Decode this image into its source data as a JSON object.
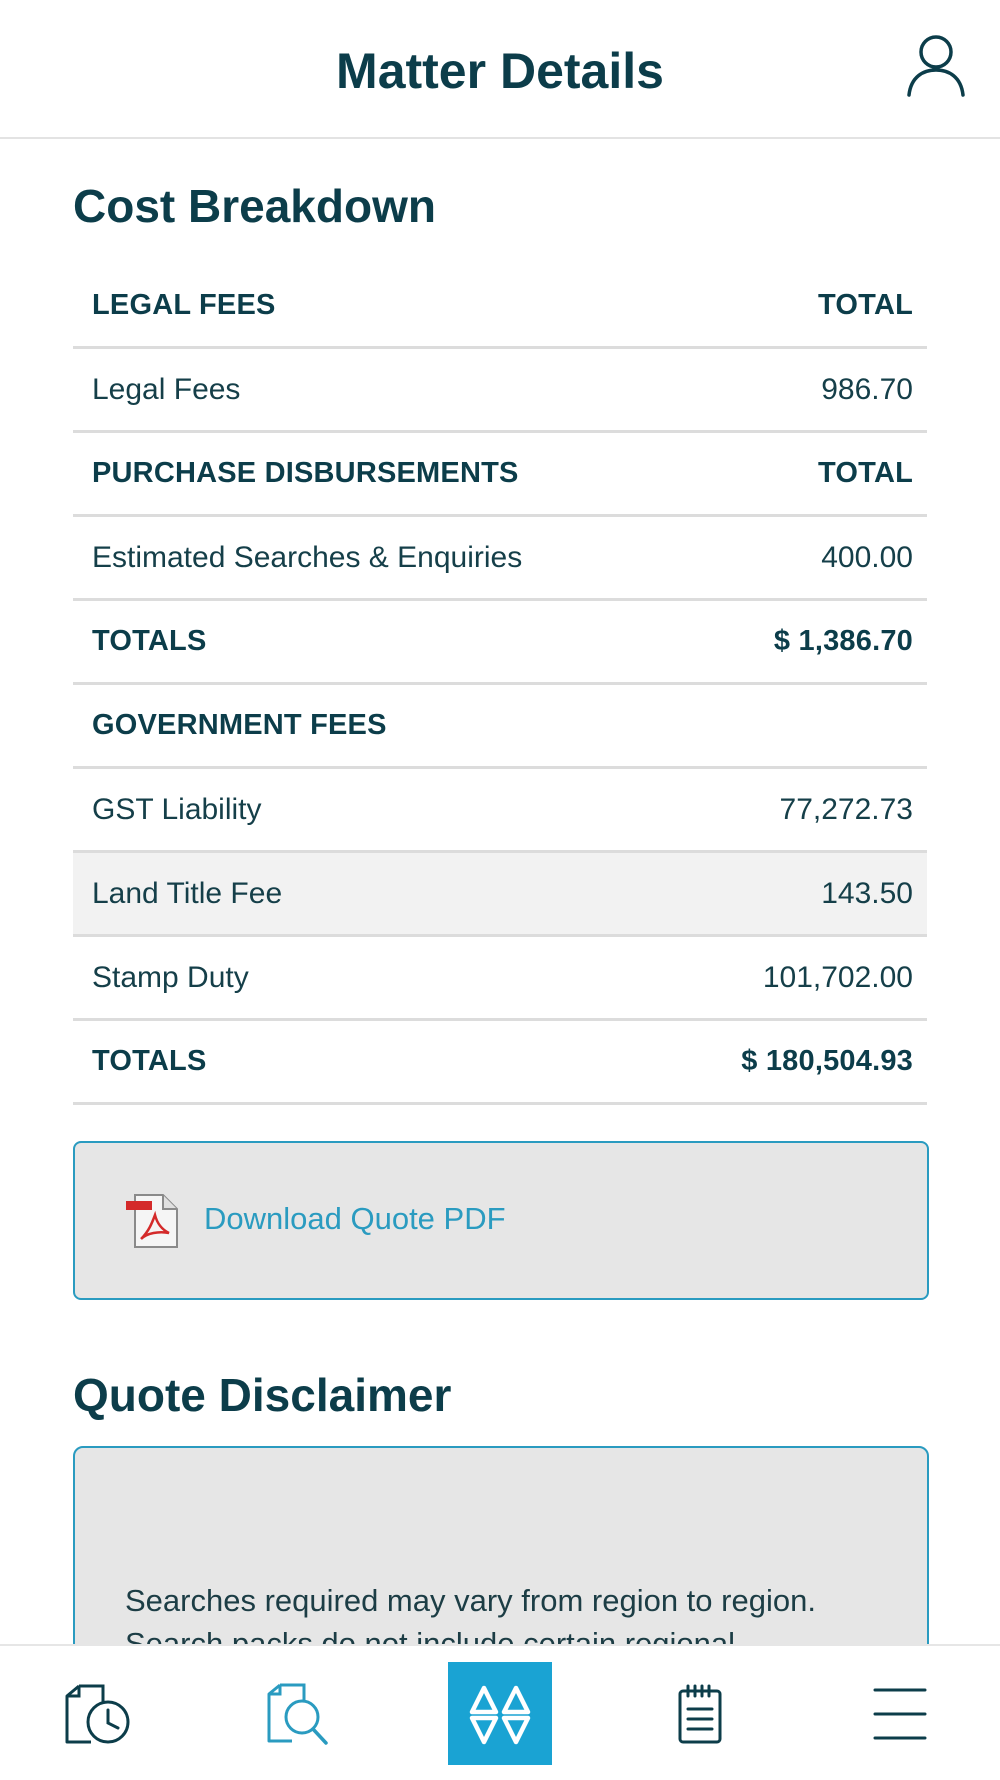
{
  "header": {
    "title": "Matter Details",
    "profile_icon": "user-icon"
  },
  "cost_breakdown": {
    "title": "Cost Breakdown",
    "rows": [
      {
        "type": "head",
        "label": "LEGAL FEES",
        "value": "TOTAL"
      },
      {
        "type": "item",
        "label": "Legal Fees",
        "value": "986.70"
      },
      {
        "type": "head",
        "label": "PURCHASE DISBURSEMENTS",
        "value": "TOTAL"
      },
      {
        "type": "item",
        "label": "Estimated Searches & Enquiries",
        "value": "400.00"
      },
      {
        "type": "head",
        "label": "TOTALS",
        "value": "$ 1,386.70"
      },
      {
        "type": "head",
        "label": "GOVERNMENT FEES",
        "value": ""
      },
      {
        "type": "item",
        "label": "GST Liability",
        "value": "77,272.73"
      },
      {
        "type": "item",
        "label": "Land Title Fee",
        "value": "143.50"
      },
      {
        "type": "item",
        "label": "Stamp Duty",
        "value": "101,702.00"
      },
      {
        "type": "head",
        "label": "TOTALS",
        "value": "$ 180,504.93"
      }
    ]
  },
  "download": {
    "label": "Download Quote PDF",
    "icon": "pdf-file-icon"
  },
  "disclaimer": {
    "title": "Quote Disclaimer",
    "text": "Searches required may vary from region to region.  Search packs do not include certain regional"
  },
  "bottom_nav": {
    "items": [
      "history-document-icon",
      "search-document-icon",
      "logo-home-icon",
      "notepad-icon",
      "menu-icon"
    ]
  },
  "colors": {
    "primary": "#0c3d4a",
    "accent": "#2a9bc0",
    "accent_fill": "#1aa3d3"
  }
}
